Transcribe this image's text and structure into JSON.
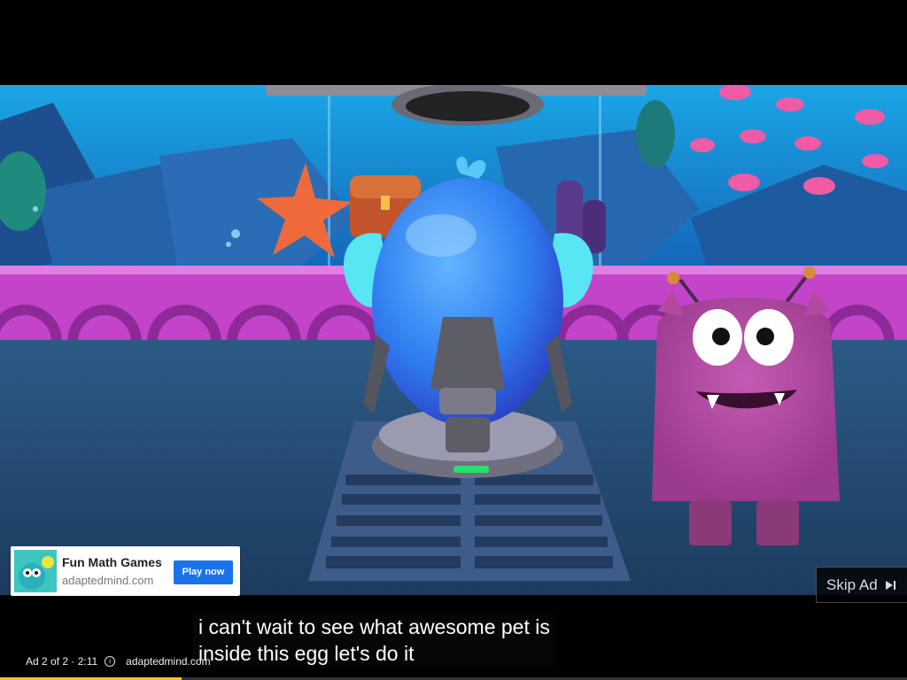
{
  "ad_card": {
    "title": "Fun Math Games",
    "domain": "adaptedmind.com",
    "cta_label": "Play now"
  },
  "skip_button": {
    "label": "Skip Ad",
    "icon": "skip-next-icon"
  },
  "captions": {
    "line1": "i can't wait to see what awesome pet is",
    "line2": "inside this egg let's do it"
  },
  "ad_info": {
    "counter": "Ad 2 of 2 · 2:11",
    "info_icon": "info-icon",
    "advertiser": "adaptedmind.com"
  },
  "progress": {
    "fraction": 0.2,
    "color": "#f6c90e"
  },
  "colors": {
    "cta": "#1a73e8",
    "egg": "#2f7cf0",
    "monster": "#b44aa0",
    "wall": "#c344c8",
    "aquarium": "#1a8bd6"
  }
}
